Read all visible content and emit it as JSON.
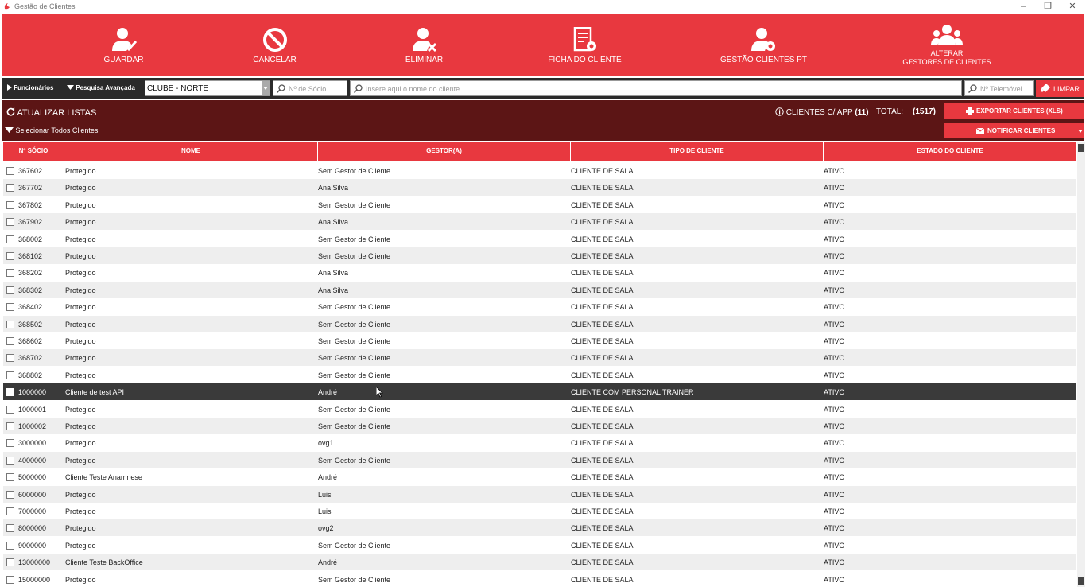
{
  "window": {
    "title": "Gestão de Clientes"
  },
  "toolbar": {
    "guardar": "GUARDAR",
    "cancelar": "CANCELAR",
    "eliminar": "ELIMINAR",
    "ficha": "FICHA DO CLIENTE",
    "gestao_pt": "GESTÃO CLIENTES PT",
    "alterar_1": "ALTERAR",
    "alterar_2": "GESTORES DE CLIENTES"
  },
  "filters": {
    "funcionarios": "Funcionários",
    "pesquisa": "Pesquisa Avançada",
    "clube": "CLUBE - NORTE",
    "socio_placeholder": "Nº de Sócio...",
    "nome_placeholder": "Insere aqui o nome do cliente...",
    "telemovel_placeholder": "Nº Telemóvel...",
    "limpar": "LIMPAR"
  },
  "info": {
    "atualizar": "ATUALIZAR LISTAS",
    "selecionar": "Selecionar Todos Clientes",
    "clientes_app": "CLIENTES C/ APP",
    "clientes_app_count": "(11)",
    "total_label": "TOTAL:",
    "total_value": "(1517)",
    "exportar": "EXPORTAR CLIENTES (XLS)",
    "notificar": "NOTIFICAR CLIENTES"
  },
  "table": {
    "columns": [
      "Nº SÓCIO",
      "NOME",
      "GESTOR(A)",
      "TIPO DE CLIENTE",
      "ESTADO DO CLIENTE"
    ],
    "selected_index": 13,
    "rows": [
      [
        "367602",
        "Protegido",
        "Sem Gestor de Cliente",
        "CLIENTE DE SALA",
        "ATIVO"
      ],
      [
        "367702",
        "Protegido",
        "Ana Silva",
        "CLIENTE DE SALA",
        "ATIVO"
      ],
      [
        "367802",
        "Protegido",
        "Sem Gestor de Cliente",
        "CLIENTE DE SALA",
        "ATIVO"
      ],
      [
        "367902",
        "Protegido",
        "Ana Silva",
        "CLIENTE DE SALA",
        "ATIVO"
      ],
      [
        "368002",
        "Protegido",
        "Sem Gestor de Cliente",
        "CLIENTE DE SALA",
        "ATIVO"
      ],
      [
        "368102",
        "Protegido",
        "Sem Gestor de Cliente",
        "CLIENTE DE SALA",
        "ATIVO"
      ],
      [
        "368202",
        "Protegido",
        "Ana Silva",
        "CLIENTE DE SALA",
        "ATIVO"
      ],
      [
        "368302",
        "Protegido",
        "Ana Silva",
        "CLIENTE DE SALA",
        "ATIVO"
      ],
      [
        "368402",
        "Protegido",
        "Sem Gestor de Cliente",
        "CLIENTE DE SALA",
        "ATIVO"
      ],
      [
        "368502",
        "Protegido",
        "Sem Gestor de Cliente",
        "CLIENTE DE SALA",
        "ATIVO"
      ],
      [
        "368602",
        "Protegido",
        "Sem Gestor de Cliente",
        "CLIENTE DE SALA",
        "ATIVO"
      ],
      [
        "368702",
        "Protegido",
        "Sem Gestor de Cliente",
        "CLIENTE DE SALA",
        "ATIVO"
      ],
      [
        "368802",
        "Protegido",
        "Sem Gestor de Cliente",
        "CLIENTE DE SALA",
        "ATIVO"
      ],
      [
        "1000000",
        "Cliente de test API",
        "André",
        "CLIENTE COM PERSONAL TRAINER",
        "ATIVO"
      ],
      [
        "1000001",
        "Protegido",
        "Sem Gestor de Cliente",
        "CLIENTE DE SALA",
        "ATIVO"
      ],
      [
        "1000002",
        "Protegido",
        "Sem Gestor de Cliente",
        "CLIENTE DE SALA",
        "ATIVO"
      ],
      [
        "3000000",
        "Protegido",
        "ovg1",
        "CLIENTE DE SALA",
        "ATIVO"
      ],
      [
        "4000000",
        "Protegido",
        "Sem Gestor de Cliente",
        "CLIENTE DE SALA",
        "ATIVO"
      ],
      [
        "5000000",
        "Cliente Teste Anamnese",
        "André",
        "CLIENTE DE SALA",
        "ATIVO"
      ],
      [
        "6000000",
        "Protegido",
        "Luis",
        "CLIENTE DE SALA",
        "ATIVO"
      ],
      [
        "7000000",
        "Protegido",
        "Luis",
        "CLIENTE DE SALA",
        "ATIVO"
      ],
      [
        "8000000",
        "Protegido",
        "ovg2",
        "CLIENTE DE SALA",
        "ATIVO"
      ],
      [
        "9000000",
        "Protegido",
        "Sem Gestor de Cliente",
        "CLIENTE DE SALA",
        "ATIVO"
      ],
      [
        "13000000",
        "Cliente Teste BackOffice",
        "André",
        "CLIENTE DE SALA",
        "ATIVO"
      ],
      [
        "15000000",
        "Protegido",
        "Sem Gestor de Cliente",
        "CLIENTE DE SALA",
        "ATIVO"
      ]
    ]
  },
  "colors": {
    "accent": "#e8383f",
    "dark_bar": "#5c1515",
    "filter_bar": "#2a2a2a",
    "selected_row": "#3a3a3a"
  }
}
